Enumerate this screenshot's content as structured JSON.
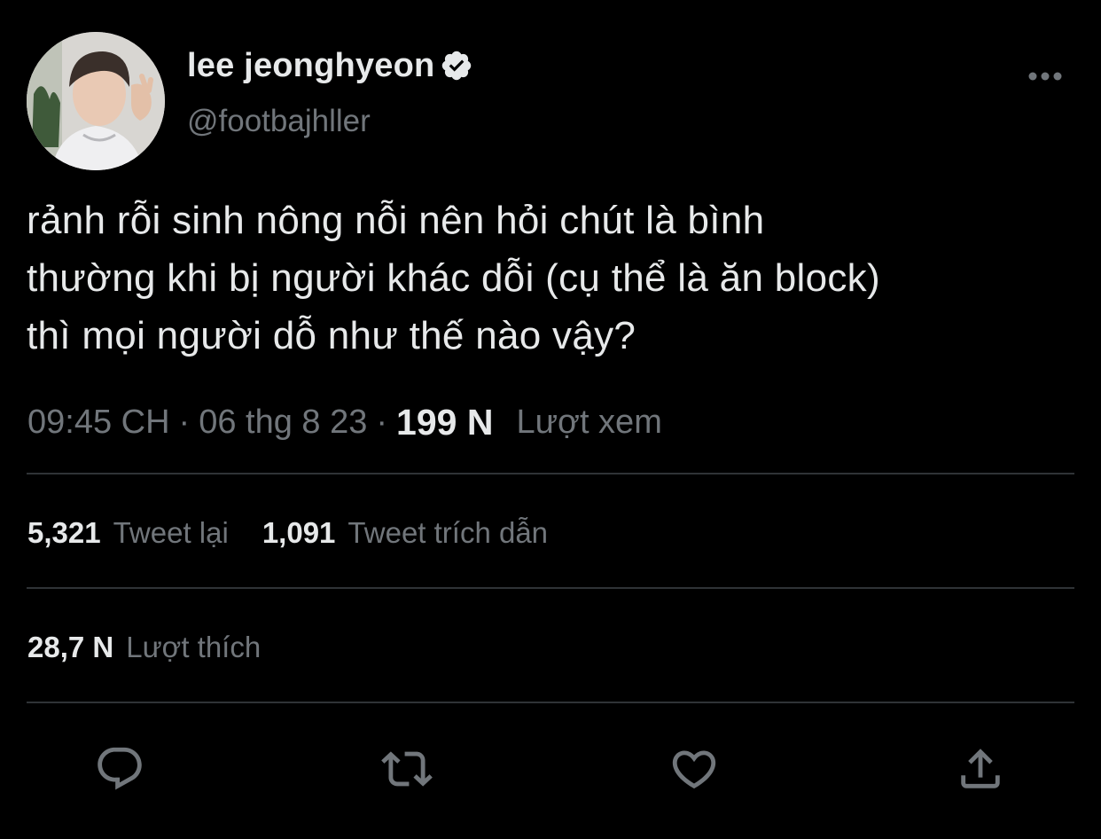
{
  "author": {
    "display_name": "lee jeonghyeon",
    "handle": "@footbajhller",
    "verified": true
  },
  "tweet": {
    "text": "rảnh rỗi sinh nông nỗi nên hỏi chút là bình\nthường khi bị người khác dỗi (cụ thể là ăn block)\nthì mọi người dỗ như thế nào vậy?"
  },
  "meta": {
    "time": "09:45 CH",
    "separator": "·",
    "date": "06 thg 8 23",
    "views_count": "199 N",
    "views_label": "Lượt xem"
  },
  "stats": {
    "retweets_count": "5,321",
    "retweets_label": "Tweet lại",
    "quotes_count": "1,091",
    "quotes_label": "Tweet trích dẫn",
    "likes_count": "28,7 N",
    "likes_label": "Lượt thích"
  },
  "icons": {
    "more": "more-horizontal-icon",
    "verified": "verified-badge-icon",
    "reply": "reply-icon",
    "retweet": "retweet-icon",
    "like": "heart-icon",
    "share": "share-icon"
  },
  "colors": {
    "background": "#000000",
    "primary_text": "#e7e9ea",
    "secondary_text": "#71767b",
    "divider": "#2f3336"
  }
}
